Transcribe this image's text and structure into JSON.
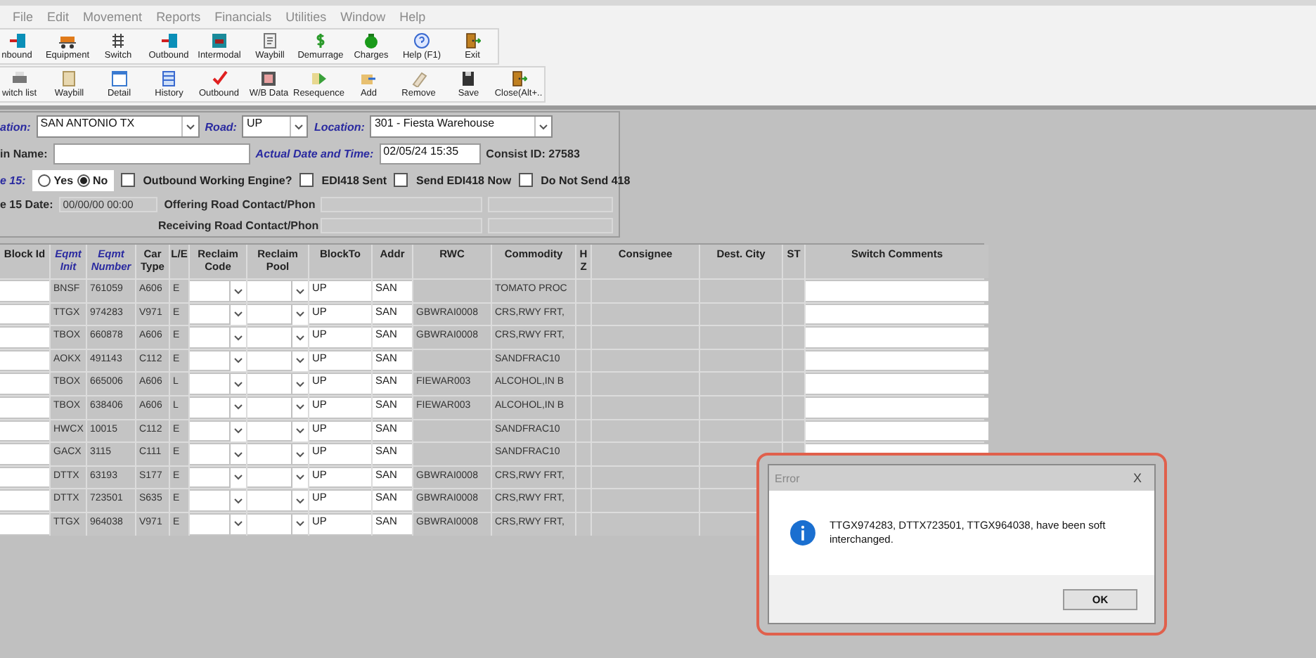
{
  "menu": [
    "File",
    "Edit",
    "Movement",
    "Reports",
    "Financials",
    "Utilities",
    "Window",
    "Help"
  ],
  "toolbars": [
    [
      {
        "label": "nbound"
      },
      {
        "label": "Equipment"
      },
      {
        "label": "Switch"
      },
      {
        "label": "Outbound"
      },
      {
        "label": "Intermodal"
      },
      {
        "label": "Waybill"
      },
      {
        "label": "Demurrage"
      },
      {
        "label": "Charges"
      },
      {
        "label": "Help (F1)"
      },
      {
        "label": "Exit"
      }
    ],
    [
      {
        "label": "witch list"
      },
      {
        "label": "Waybill"
      },
      {
        "label": "Detail"
      },
      {
        "label": "History"
      },
      {
        "label": "Outbound"
      },
      {
        "label": "W/B Data"
      },
      {
        "label": "Resequence"
      },
      {
        "label": "Add"
      },
      {
        "label": "Remove"
      },
      {
        "label": "Save"
      },
      {
        "label": "Close(Alt+.."
      }
    ]
  ],
  "form": {
    "station": {
      "label": "ation:",
      "value": "SAN ANTONIO TX"
    },
    "road": {
      "label": "Road:",
      "value": "UP"
    },
    "location": {
      "label": "Location:",
      "value": "301 - Fiesta Warehouse"
    },
    "train_name": {
      "label": "in Name:"
    },
    "actual_date_time": {
      "label": "Actual Date and Time:",
      "value": "02/05/24 15:35"
    },
    "consist_id": {
      "label": "Consist ID:",
      "value": "27583"
    },
    "rule15": {
      "label": "e 15:",
      "options": [
        {
          "label": "Yes",
          "selected": false
        },
        {
          "label": "No",
          "selected": true
        }
      ]
    },
    "checks": [
      {
        "label": "Outbound Working Engine?",
        "checked": false
      },
      {
        "label": "EDI418 Sent",
        "checked": false
      },
      {
        "label": "Send EDI418 Now",
        "checked": false
      },
      {
        "label": "Do Not Send 418",
        "checked": false
      }
    ],
    "rule15_date": {
      "label": "e 15 Date:",
      "value": "00/00/00 00:00"
    },
    "contacts": [
      {
        "label": "Offering Road Contact/Phon"
      },
      {
        "label": "Receiving Road Contact/Phon"
      }
    ]
  },
  "grid": {
    "columns": [
      {
        "label": "Block Id",
        "highlight": false
      },
      {
        "label": "Eqmt Init",
        "highlight": true
      },
      {
        "label": "Eqmt Number",
        "highlight": true
      },
      {
        "label": "Car Type",
        "highlight": false
      },
      {
        "label": "L/E",
        "highlight": false
      },
      {
        "label": "Reclaim Code",
        "highlight": false
      },
      {
        "label": "Reclaim Pool",
        "highlight": false
      },
      {
        "label": "BlockTo",
        "highlight": false
      },
      {
        "label": "Addr",
        "highlight": false
      },
      {
        "label": "RWC",
        "highlight": false
      },
      {
        "label": "Commodity",
        "highlight": false
      },
      {
        "label": "H Z",
        "highlight": false
      },
      {
        "label": "Consignee",
        "highlight": false
      },
      {
        "label": "Dest. City",
        "highlight": false
      },
      {
        "label": "ST",
        "highlight": false
      },
      {
        "label": "Switch Comments",
        "highlight": false
      }
    ],
    "rows": [
      {
        "init": "BNSF",
        "number": "761059",
        "car_type": "A606",
        "le": "E",
        "block_to": "UP",
        "addr": "SAN",
        "commodity": "TOMATO PROC"
      },
      {
        "init": "TTGX",
        "number": "974283",
        "car_type": "V971",
        "le": "E",
        "block_to": "UP",
        "addr": "SAN",
        "rwc": "GBWRAI0008",
        "commodity": "CRS,RWY FRT,"
      },
      {
        "init": "TBOX",
        "number": "660878",
        "car_type": "A606",
        "le": "E",
        "block_to": "UP",
        "addr": "SAN",
        "rwc": "GBWRAI0008",
        "commodity": "CRS,RWY FRT,"
      },
      {
        "init": "AOKX",
        "number": "491143",
        "car_type": "C112",
        "le": "E",
        "block_to": "UP",
        "addr": "SAN",
        "commodity": "SANDFRAC10"
      },
      {
        "init": "TBOX",
        "number": "665006",
        "car_type": "A606",
        "le": "L",
        "block_to": "UP",
        "addr": "SAN",
        "rwc": "FIEWAR003",
        "commodity": "ALCOHOL,IN B"
      },
      {
        "init": "TBOX",
        "number": "638406",
        "car_type": "A606",
        "le": "L",
        "block_to": "UP",
        "addr": "SAN",
        "rwc": "FIEWAR003",
        "commodity": "ALCOHOL,IN B"
      },
      {
        "init": "HWCX",
        "number": "10015",
        "car_type": "C112",
        "le": "E",
        "block_to": "UP",
        "addr": "SAN",
        "commodity": "SANDFRAC10"
      },
      {
        "init": "GACX",
        "number": "3115",
        "car_type": "C111",
        "le": "E",
        "block_to": "UP",
        "addr": "SAN",
        "commodity": "SANDFRAC10"
      },
      {
        "init": "DTTX",
        "number": "63193",
        "car_type": "S177",
        "le": "E",
        "block_to": "UP",
        "addr": "SAN",
        "rwc": "GBWRAI0008",
        "commodity": "CRS,RWY FRT,"
      },
      {
        "init": "DTTX",
        "number": "723501",
        "car_type": "S635",
        "le": "E",
        "block_to": "UP",
        "addr": "SAN",
        "rwc": "GBWRAI0008",
        "commodity": "CRS,RWY FRT,"
      },
      {
        "init": "TTGX",
        "number": "964038",
        "car_type": "V971",
        "le": "E",
        "block_to": "UP",
        "addr": "SAN",
        "rwc": "GBWRAI0008",
        "commodity": "CRS,RWY FRT,"
      }
    ]
  },
  "dialog": {
    "title": "Error",
    "close": "X",
    "message": "TTGX974283, DTTX723501, TTGX964038, have been soft interchanged.",
    "button": "OK"
  }
}
